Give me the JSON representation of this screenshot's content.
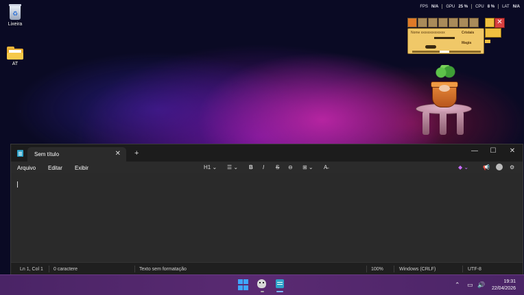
{
  "desktop": {
    "icons": [
      {
        "label": "Lixeira",
        "icon": "recycle-bin-icon"
      },
      {
        "label": "AT",
        "icon": "folder-icon"
      }
    ]
  },
  "perf_overlay": {
    "fps_label": "FPS",
    "fps_value": "N/A",
    "gpu_label": "GPU",
    "gpu_value": "25 %",
    "cpu_label": "CPU",
    "cpu_value": "8 %",
    "lat_label": "LAT",
    "lat_value": "N/A"
  },
  "game_overlay": {
    "name_label": "Nome",
    "name_value": "xxxxxxxxxxxxxx",
    "cristais_label": "Cristais",
    "magia_label": "Magia"
  },
  "notepad": {
    "tab_title": "Sem título",
    "menu": [
      "Arquivo",
      "Editar",
      "Exibir"
    ],
    "heading_select": "H1",
    "status": {
      "position": "Ln 1, Col 1",
      "chars": "0 caractere",
      "format": "Texto sem formatação",
      "zoom": "100%",
      "line_ending": "Windows (CRLF)",
      "encoding": "UTF-8"
    }
  },
  "taskbar": {
    "time": "19:31",
    "date": "22/04/2026"
  },
  "colors": {
    "accent": "#3ea6ff",
    "notepad_icon": "#2ea3c9",
    "close_red": "#d84040"
  }
}
